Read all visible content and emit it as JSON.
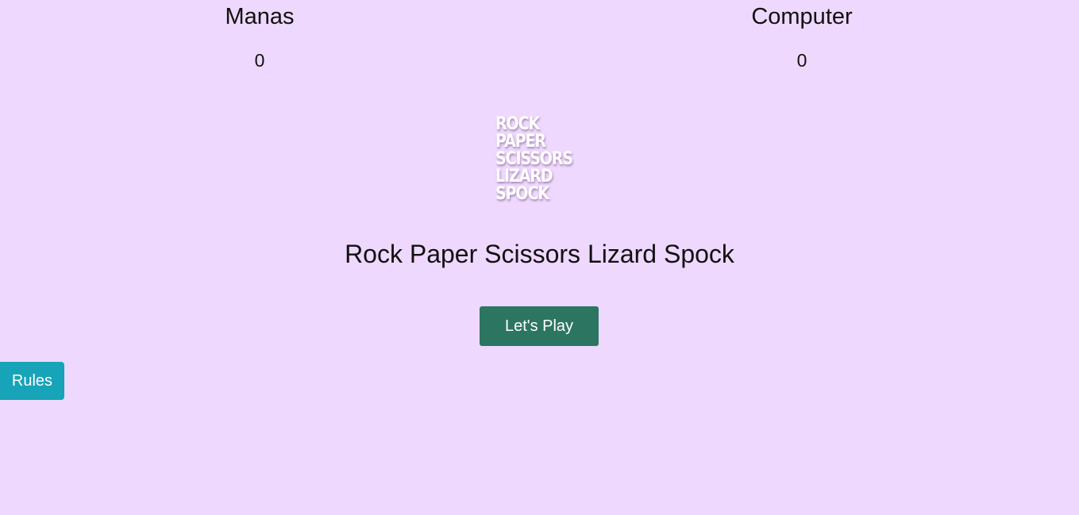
{
  "scoreboard": {
    "player": {
      "name": "Manas",
      "score": "0"
    },
    "computer": {
      "name": "Computer",
      "score": "0"
    }
  },
  "logo": {
    "words": [
      "ROCK",
      "PAPER",
      "SCISSORS",
      "LIZARD",
      "SPOCK"
    ]
  },
  "title": "Rock Paper Scissors Lizard Spock",
  "buttons": {
    "play_label": "Let's Play",
    "rules_label": "Rules"
  },
  "colors": {
    "background": "#efd8fe",
    "play_button": "#2c7661",
    "rules_button": "#17a3b8",
    "logo_text": "#ffffff"
  }
}
